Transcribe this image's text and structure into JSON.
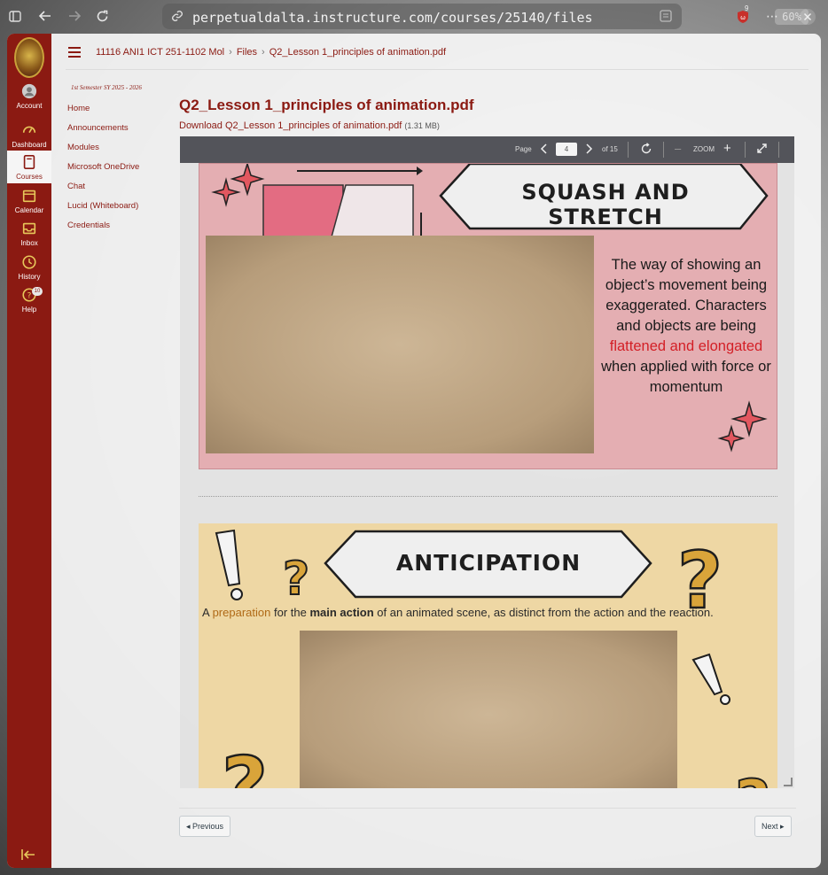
{
  "browser": {
    "url": "perpetualdalta.instructure.com/courses/25140/files",
    "zoom": "60%",
    "extension_badge": "9"
  },
  "global_nav": {
    "items": [
      {
        "label": "Account",
        "icon": "user-icon"
      },
      {
        "label": "Dashboard",
        "icon": "dashboard-icon"
      },
      {
        "label": "Courses",
        "icon": "book-icon"
      },
      {
        "label": "Calendar",
        "icon": "calendar-icon"
      },
      {
        "label": "Inbox",
        "icon": "inbox-icon"
      },
      {
        "label": "History",
        "icon": "clock-icon"
      },
      {
        "label": "Help",
        "icon": "help-icon"
      }
    ],
    "help_badge": "10"
  },
  "breadcrumb": {
    "course": "11116 ANI1 ICT 251-1102 Mol",
    "section": "Files",
    "file": "Q2_Lesson 1_principles of animation.pdf"
  },
  "course_nav": {
    "term": "1st Semester SY 2025 - 2026",
    "items": [
      "Home",
      "Announcements",
      "Modules",
      "Microsoft OneDrive",
      "Chat",
      "Lucid (Whiteboard)",
      "Credentials"
    ]
  },
  "file": {
    "title": "Q2_Lesson 1_principles of animation.pdf",
    "download_label": "Download Q2_Lesson 1_principles of animation.pdf",
    "size": "(1.31 MB)"
  },
  "viewer": {
    "page_label": "Page",
    "current_page": "4",
    "of_total": "of 15",
    "zoom_label": "ZOOM"
  },
  "slides": {
    "s1": {
      "title": "SQUASH AND STRETCH",
      "desc_a": "The way of showing an object’s movement being exaggerated. Characters and objects are being ",
      "desc_hl": "flattened and elongated",
      "desc_b": " when applied with force or momentum"
    },
    "s2": {
      "title": "ANTICIPATION",
      "p1": "A ",
      "p2": "preparation",
      "p3": " for the ",
      "p4": "main action",
      "p5": " of an animated scene, as distinct from the action and the reaction."
    }
  },
  "footer": {
    "previous": "◂ Previous",
    "next": "Next ▸"
  },
  "colors": {
    "brand": "#8b1a12",
    "slide1_bg": "#e4aeb2",
    "slide2_bg": "#eed7a4",
    "highlight_red": "#d31f26",
    "highlight_orange": "#b06a17"
  }
}
